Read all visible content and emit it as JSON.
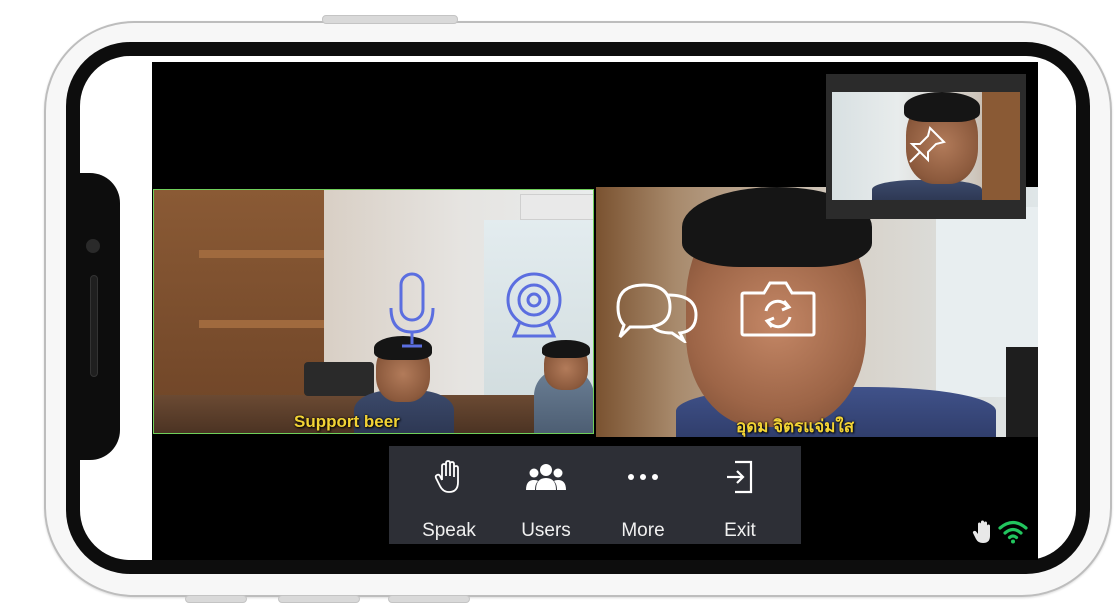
{
  "toolbar": {
    "speak_label": "Speak",
    "users_label": "Users",
    "more_label": "More",
    "exit_label": "Exit"
  },
  "participants": {
    "left_name": "Support beer",
    "right_name": "อุดม จิตรแจ่มใส"
  },
  "colors": {
    "accent_name": "#f2d335",
    "active_border": "#6fcf5a",
    "toolbar_bg": "#2d2f36",
    "wifi": "#22c55e"
  },
  "icons": {
    "speak": "raised-hand-icon",
    "users": "users-icon",
    "more": "more-dots-icon",
    "exit": "exit-icon",
    "mic": "microphone-icon",
    "webcam": "webcam-icon",
    "chat": "chat-bubbles-icon",
    "switch_camera": "switch-camera-icon",
    "pin": "pin-icon",
    "hand_status": "hand-status-icon",
    "wifi": "wifi-icon"
  }
}
